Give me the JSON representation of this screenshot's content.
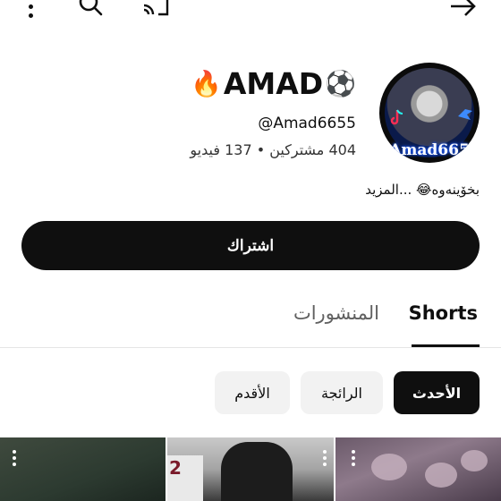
{
  "channel": {
    "name": "AMAD",
    "name_prefix_emoji": "🔥",
    "name_suffix_emoji": "⚽",
    "handle": "@Amad6655",
    "stats": "404 مشتركين • 137 فيديو",
    "description": "بخۆينەوە😂 ...المزيد",
    "avatar_label": "Amad665"
  },
  "actions": {
    "subscribe_label": "اشتراك"
  },
  "tabs": [
    {
      "label": "Shorts",
      "selected": true
    },
    {
      "label": "المنشورات",
      "selected": false
    }
  ],
  "filters": [
    {
      "label": "الأحدث",
      "selected": true
    },
    {
      "label": "الرائجة",
      "selected": false
    },
    {
      "label": "الأقدم",
      "selected": false
    }
  ],
  "thumbnails": [
    {
      "overlay_text": ""
    },
    {
      "overlay_text": "2"
    },
    {
      "overlay_text": ""
    }
  ],
  "icons": {
    "top_left": "more-vertical-icon",
    "search": "search-icon",
    "cast": "cast-icon",
    "back": "arrow-right-icon"
  },
  "colors": {
    "primary_button": "#0f0f0f",
    "chip_selected": "#0f0f0f",
    "chip_default": "#f2f2f2",
    "tab_inactive": "#606060"
  }
}
